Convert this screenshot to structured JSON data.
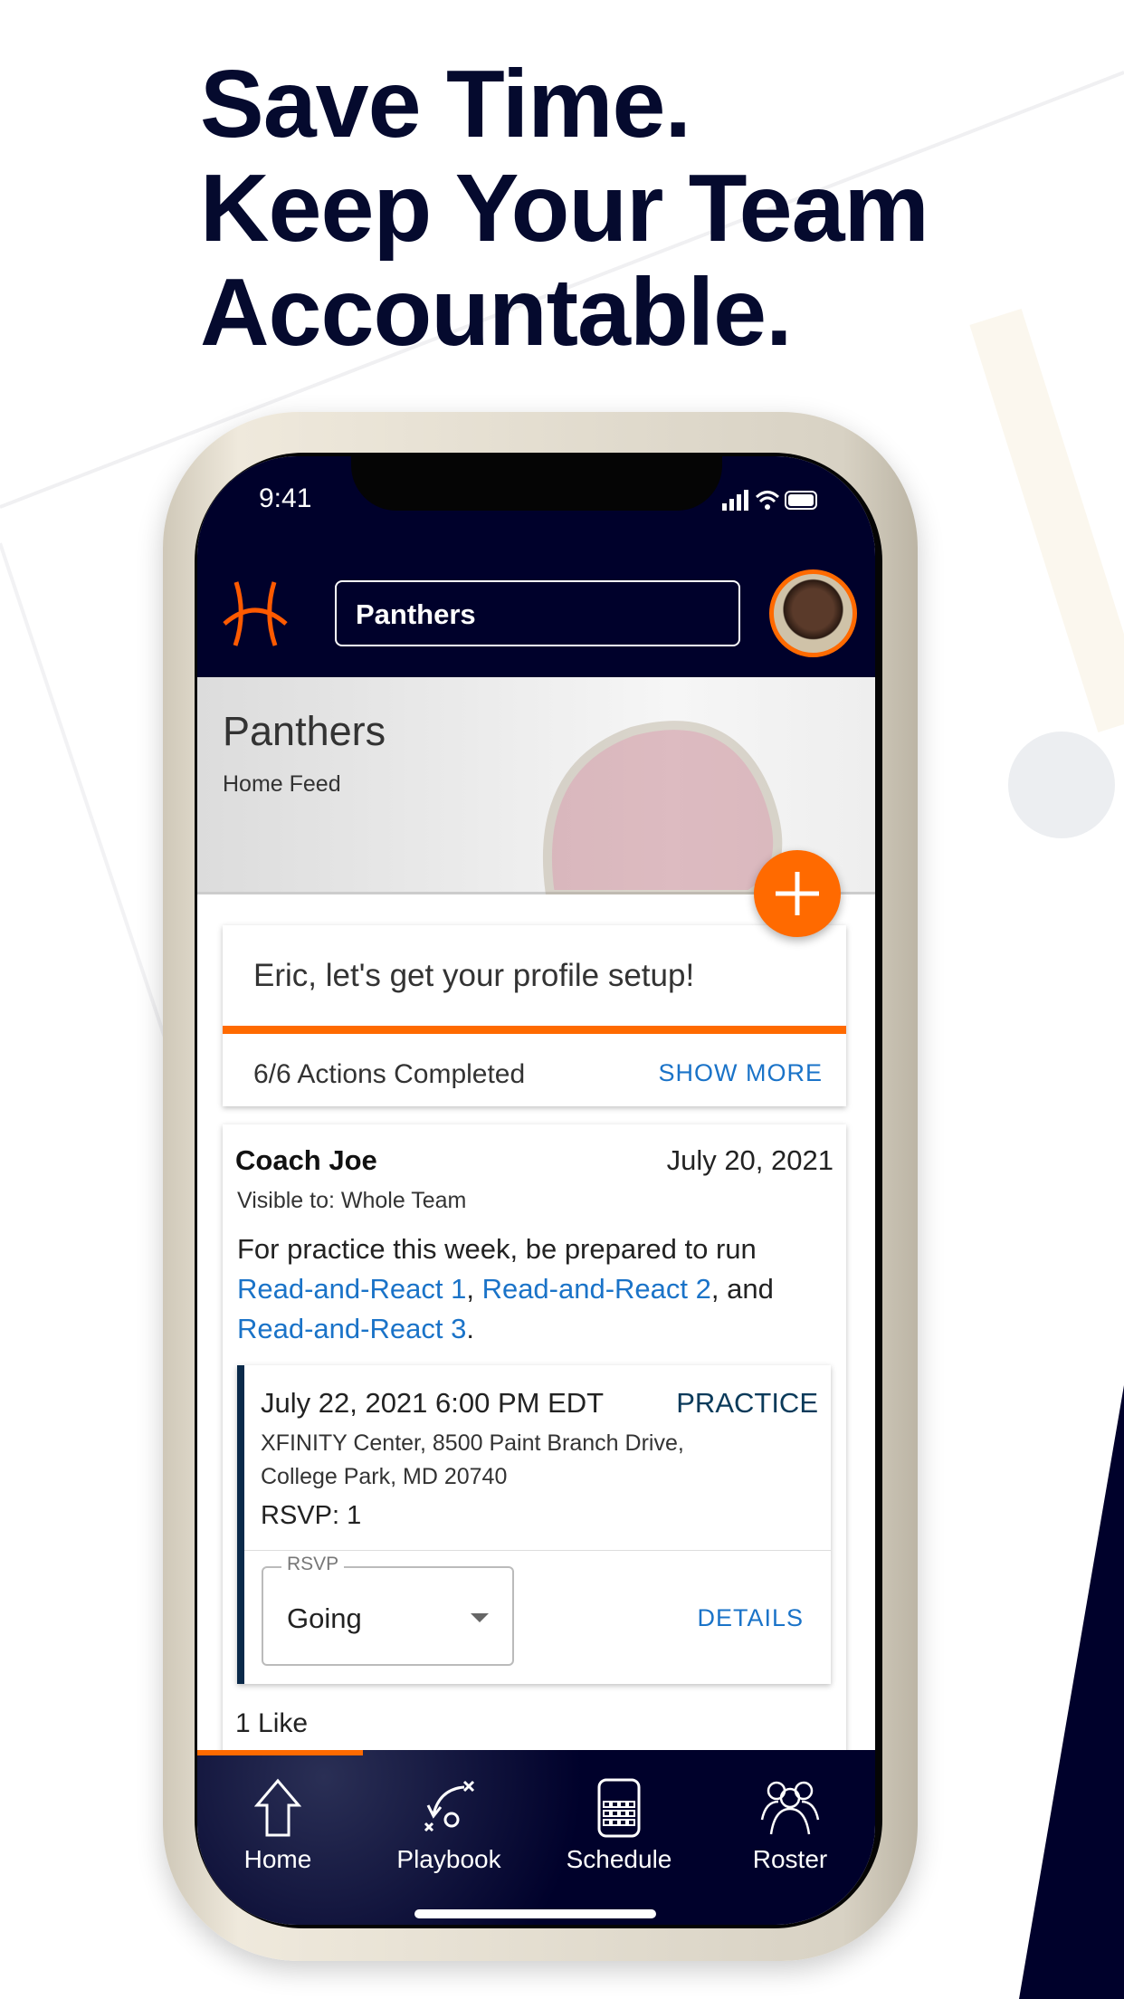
{
  "headline": [
    "Save Time.",
    "Keep Your Team",
    "Accountable."
  ],
  "status_bar": {
    "time": "9:41"
  },
  "header": {
    "team_select": "Panthers"
  },
  "banner": {
    "title": "Panthers",
    "subtitle": "Home Feed"
  },
  "profile_card": {
    "message": "Eric, let's get your profile setup!",
    "progress": "6/6 Actions Completed",
    "progress_fraction": 1.0,
    "show_more": "SHOW MORE"
  },
  "post": {
    "author": "Coach Joe",
    "date": "July 20, 2021",
    "visibility": "Visible to: Whole Team",
    "body_prefix": "For practice this week, be prepared to run ",
    "link1": "Read-and-React 1",
    "sep1": ", ",
    "link2": "Read-and-React 2",
    "sep2": ", and ",
    "link3": "Read-and-React 3",
    "body_suffix": ".",
    "likes": "1 Like"
  },
  "event": {
    "datetime": "July 22, 2021 6:00 PM EDT",
    "type": "PRACTICE",
    "address1": "XFINITY Center, 8500 Paint Branch Drive,",
    "address2": "College Park, MD 20740",
    "rsvp_count": "RSVP: 1",
    "rsvp_label": "RSVP",
    "rsvp_value": "Going",
    "details": "DETAILS"
  },
  "tabs": [
    {
      "label": "Home",
      "icon": "home-icon"
    },
    {
      "label": "Playbook",
      "icon": "playbook-icon"
    },
    {
      "label": "Schedule",
      "icon": "calendar-icon"
    },
    {
      "label": "Roster",
      "icon": "roster-icon"
    }
  ],
  "colors": {
    "navy": "#00012b",
    "orange": "#ff6a00",
    "link": "#1a73c8"
  }
}
